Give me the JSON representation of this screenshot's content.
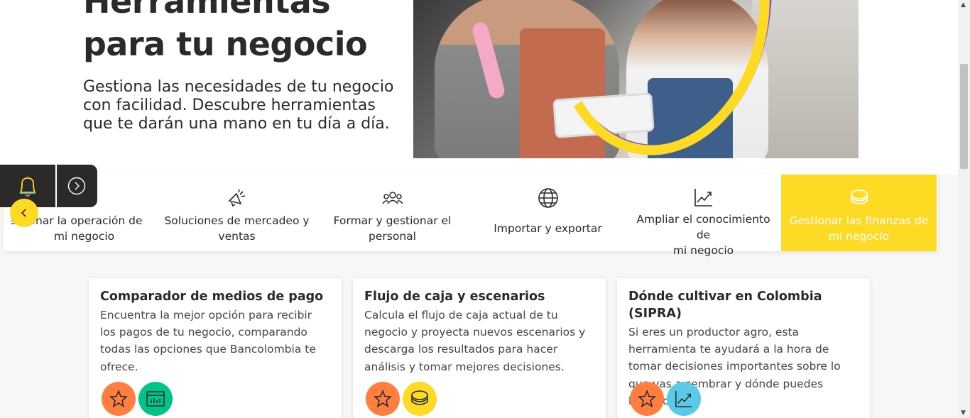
{
  "hero": {
    "title_line1": "Herramientas",
    "title_line2": "para tu negocio",
    "description": "Gestiona las necesidades de tu negocio con facilidad. Descubre herramientas que te darán una mano en tu día a día."
  },
  "tabs": [
    {
      "line1": "Gestionar la operación de",
      "line2": "mi negocio",
      "icon": "gear-icon",
      "active": false
    },
    {
      "line1": "Soluciones de mercadeo y",
      "line2": "ventas",
      "icon": "megaphone-icon",
      "active": false
    },
    {
      "line1": "Formar y gestionar el",
      "line2": "personal",
      "icon": "people-icon",
      "active": false
    },
    {
      "line1": "Importar y exportar",
      "line2": "",
      "icon": "globe-icon",
      "active": false
    },
    {
      "line1": "Ampliar el conocimiento de",
      "line2": "mi negocio",
      "icon": "chart-up-icon",
      "active": false
    },
    {
      "line1": "Gestionar las finanzas de",
      "line2": "mi negocio",
      "icon": "coins-icon",
      "active": true
    }
  ],
  "cards": [
    {
      "title": "Comparador de medios de pago",
      "description": "Encuentra la mejor opción para recibir los pagos de tu negocio, comparando todas las opciones que Bancolombia te ofrece.",
      "icons": [
        "star-icon",
        "dashboard-icon"
      ]
    },
    {
      "title": "Flujo de caja y escenarios",
      "description": "Calcula el flujo de caja actual de tu negocio y proyecta nuevos escenarios y descarga los resultados para hacer análisis y tomar mejores decisiones.",
      "icons": [
        "star-icon",
        "coins-icon"
      ]
    },
    {
      "title": "Dónde cultivar en Colombia (SIPRA)",
      "description": "Si eres un productor agro, esta herramienta te ayudará a la hora de tomar decisiones importantes sobre lo que vas a sembrar y dónde puedes hacerlo.",
      "icons": [
        "star-icon",
        "chart-up-icon"
      ]
    }
  ],
  "colors": {
    "brand_yellow": "#FDDA24",
    "orange": "#FF7F41",
    "green": "#00C389",
    "blue": "#59CBE8",
    "purple": "#8F52C7",
    "dark": "#2C2A29"
  }
}
